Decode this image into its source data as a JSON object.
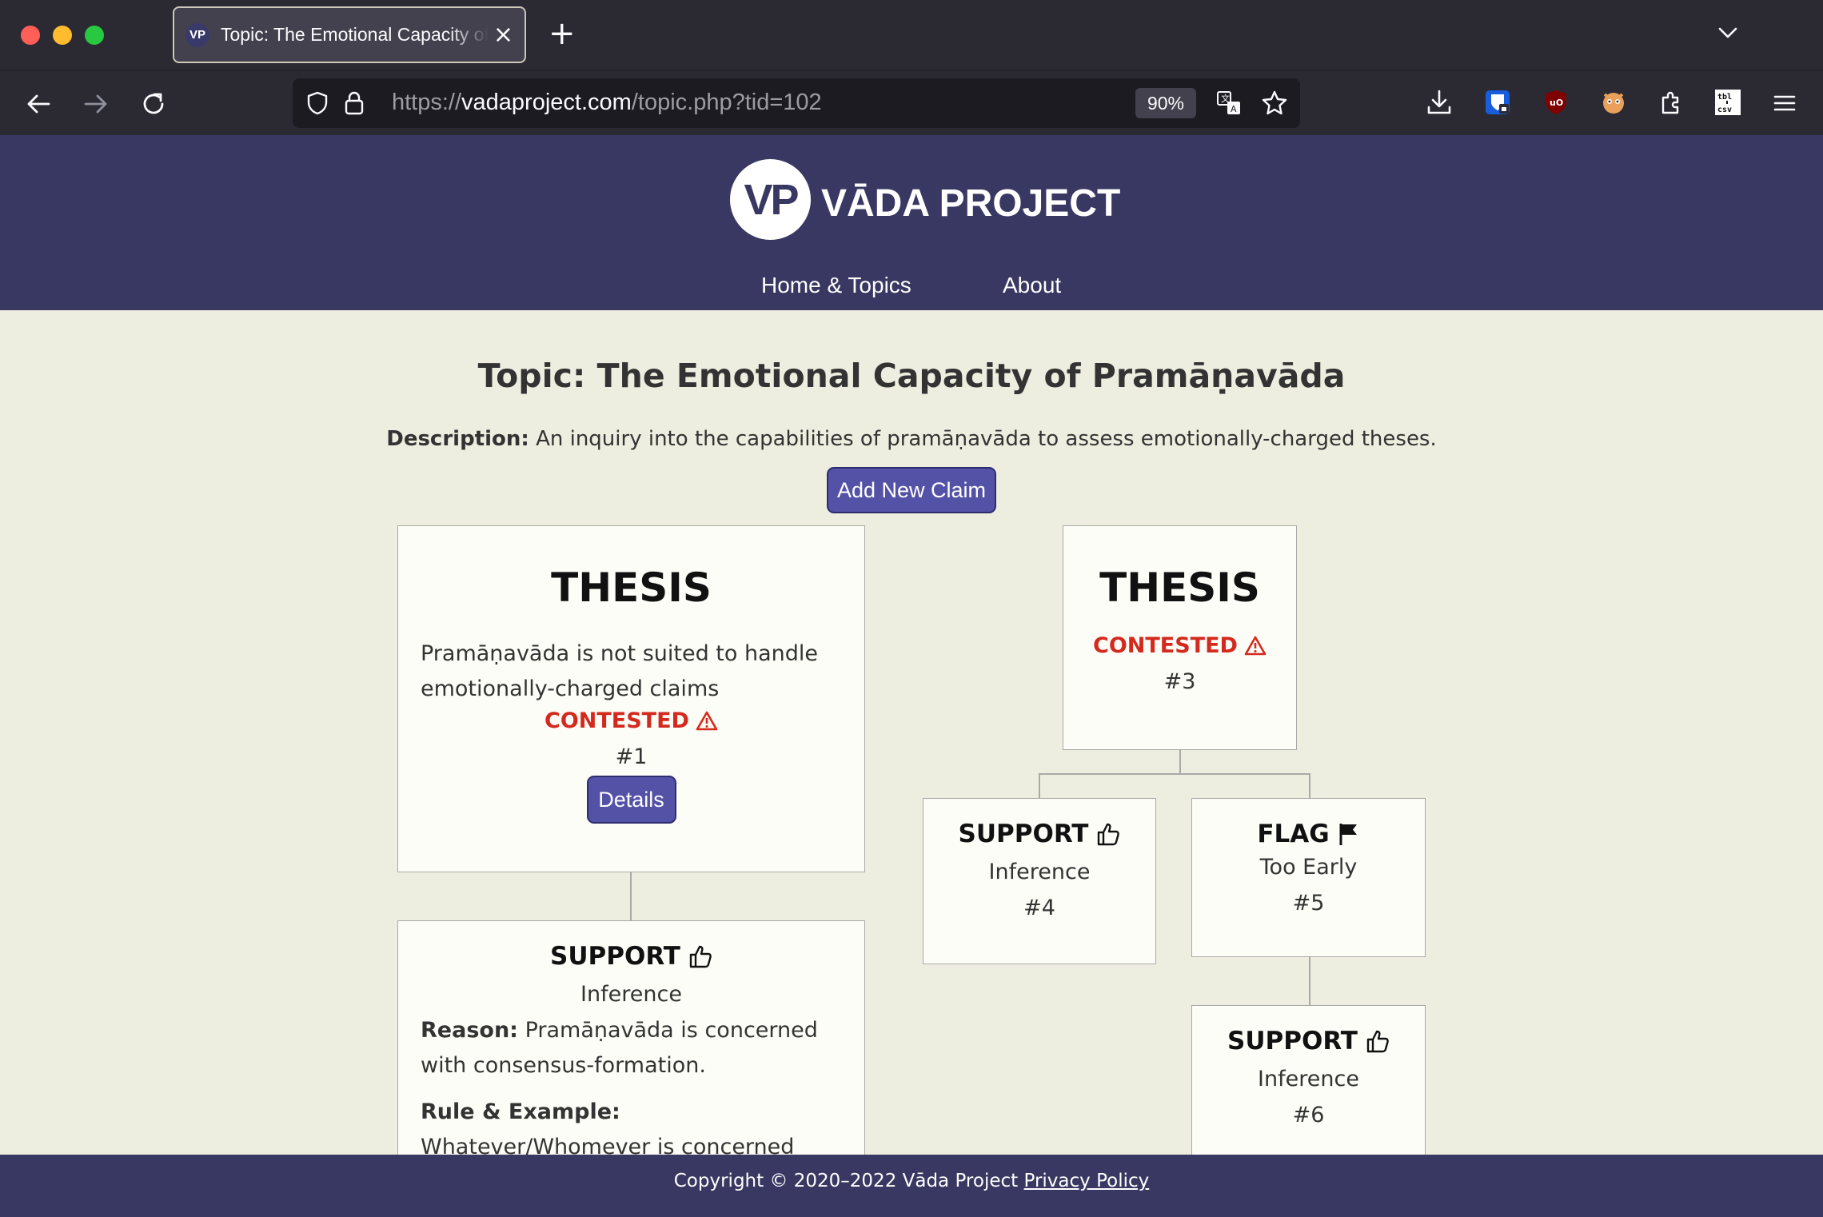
{
  "browser": {
    "tab_title": "Topic: The Emotional Capacity of Pramāṇavāda",
    "tab_favicon": "VP",
    "new_tab": "+",
    "url_scheme": "https://",
    "url_host": "vadaproject.com",
    "url_path": "/topic.php?tid=102",
    "zoom": "90%"
  },
  "site": {
    "logo_initials": "VP",
    "logo_name": "VĀDA PROJECT",
    "nav": [
      "Home & Topics",
      "About"
    ]
  },
  "topic": {
    "title": "Topic: The Emotional Capacity of Pramāṇavāda",
    "desc_label": "Description:",
    "desc_text": "An inquiry into the capabilities of pramāṇavāda to assess emotionally-charged theses.",
    "add_claim": "Add New Claim"
  },
  "claims": {
    "c1": {
      "type": "THESIS",
      "text": "Pramāṇavāda is not suited to handle emotionally-charged claims",
      "status": "CONTESTED",
      "id": "#1",
      "button": "Details"
    },
    "c2": {
      "type": "SUPPORT",
      "subtype": "Inference",
      "reason_label": "Reason:",
      "reason": "Pramāṇavāda is concerned with consensus-formation.",
      "rule_label": "Rule & Example:",
      "rule": "Whatever/Whomever is concerned with consensus-formation is"
    },
    "c3": {
      "type": "THESIS",
      "status": "CONTESTED",
      "id": "#3"
    },
    "c4": {
      "type": "SUPPORT",
      "subtype": "Inference",
      "id": "#4"
    },
    "c5": {
      "type": "FLAG",
      "subtype": "Too Early",
      "id": "#5"
    },
    "c6": {
      "type": "SUPPORT",
      "subtype": "Inference",
      "id": "#6"
    }
  },
  "footer": {
    "copyright": "Copyright © 2020–2022 Vāda Project",
    "privacy": "Privacy Policy"
  },
  "colors": {
    "header_bg": "#393862",
    "page_bg": "#eeeee0",
    "button_bg": "#5452a7",
    "contested": "#d42a1e"
  },
  "icons": [
    "back-arrow-icon",
    "forward-arrow-icon",
    "reload-icon",
    "shield-icon",
    "lock-icon",
    "translate-icon",
    "bookmark-star-icon",
    "download-icon",
    "bitwarden-icon",
    "ublock-icon",
    "extension-fox-icon",
    "extensions-puzzle-icon",
    "table-csv-icon",
    "hamburger-menu-icon",
    "thumbs-up-icon",
    "flag-icon",
    "warning-triangle-icon"
  ]
}
